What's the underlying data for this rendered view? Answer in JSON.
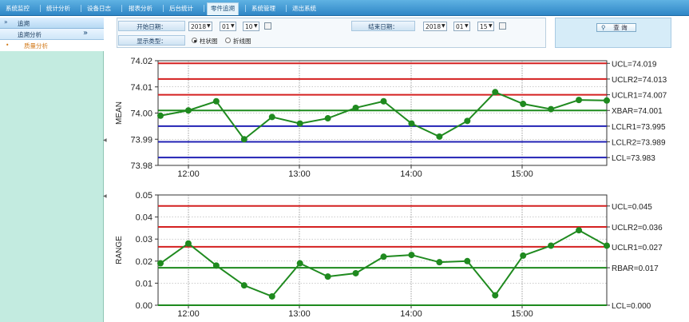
{
  "nav": {
    "items": [
      "系统监控",
      "统计分析",
      "设备日志",
      "报表分析",
      "后台统计",
      "零件追溯",
      "系统管理",
      "退出系统"
    ],
    "active_index": 5
  },
  "sidebar": {
    "header": "追溯",
    "header_icon": "double-chevron-right-icon",
    "sub_header": "追溯分析",
    "sub_icon": "double-chevron-right-icon",
    "item": "质量分析",
    "item_bullet": "•"
  },
  "filters": {
    "start_label": "开始日期：",
    "end_label": "结束日期：",
    "display_label": "显示类型：",
    "start": {
      "year": "2018",
      "month": "01",
      "day": "10"
    },
    "end": {
      "year": "2018",
      "month": "01",
      "day": "15"
    },
    "dropdown_arrow": "▼",
    "options": [
      "柱状图",
      "折线图"
    ],
    "selected_option": "柱状图",
    "query_button": "查 询"
  },
  "colors": {
    "control_line": "#d42020",
    "warning_line": "#2222b5",
    "center_line": "#1d8a1d",
    "series": "#1f8a1f"
  },
  "chart_data": [
    {
      "type": "line",
      "ylabel": "MEAN",
      "ylim": [
        73.98,
        74.02
      ],
      "yticks": [
        "73.98",
        "73.99",
        "74.00",
        "74.01",
        "74.02"
      ],
      "x_ticks": [
        "12:00",
        "13:00",
        "14:00",
        "15:00"
      ],
      "x": [
        0,
        1,
        2,
        3,
        4,
        5,
        6,
        7,
        8,
        9,
        10,
        11,
        12,
        13,
        14,
        15,
        16,
        17,
        18,
        19,
        20
      ],
      "values": [
        73.999,
        74.001,
        74.0045,
        73.99,
        73.9985,
        73.996,
        73.998,
        74.002,
        74.0045,
        73.996,
        73.991,
        73.997,
        74.008,
        74.0035,
        74.0015,
        74.005,
        74.0048
      ],
      "lines": [
        {
          "label": "UCL=74.019",
          "value": 74.019,
          "kind": "control"
        },
        {
          "label": "UCLR2=74.013",
          "value": 74.013,
          "kind": "control"
        },
        {
          "label": "UCLR1=74.007",
          "value": 74.007,
          "kind": "control"
        },
        {
          "label": "XBAR=74.001",
          "value": 74.001,
          "kind": "center"
        },
        {
          "label": "LCLR1=73.995",
          "value": 73.995,
          "kind": "warning"
        },
        {
          "label": "LCLR2=73.989",
          "value": 73.989,
          "kind": "warning"
        },
        {
          "label": "LCL=73.983",
          "value": 73.983,
          "kind": "warning"
        }
      ]
    },
    {
      "type": "line",
      "ylabel": "RANGE",
      "ylim": [
        0.0,
        0.05
      ],
      "yticks": [
        "0.00",
        "0.01",
        "0.02",
        "0.03",
        "0.04",
        "0.05"
      ],
      "x_ticks": [
        "12:00",
        "13:00",
        "14:00",
        "15:00"
      ],
      "values": [
        0.019,
        0.028,
        0.018,
        0.009,
        0.004,
        0.019,
        0.013,
        0.0145,
        0.022,
        0.0228,
        0.0195,
        0.02,
        0.0045,
        0.0225,
        0.027,
        0.034,
        0.027
      ],
      "lines": [
        {
          "label": "UCL=0.045",
          "value": 0.045,
          "kind": "control"
        },
        {
          "label": "UCLR2=0.036",
          "value": 0.0355,
          "kind": "control"
        },
        {
          "label": "UCLR1=0.027",
          "value": 0.0265,
          "kind": "control"
        },
        {
          "label": "RBAR=0.017",
          "value": 0.017,
          "kind": "center"
        },
        {
          "label": "LCL=0.000",
          "value": 0.0,
          "kind": "center"
        }
      ]
    }
  ]
}
